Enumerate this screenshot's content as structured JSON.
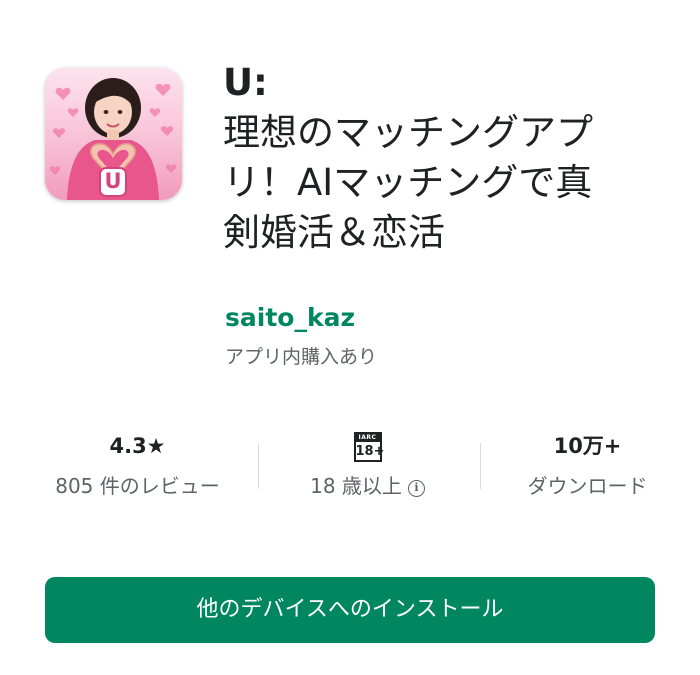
{
  "app": {
    "title_line1": "U:",
    "title_line2": "理想のマッチングアプ",
    "title_line3": "リ！AIマッチングで真",
    "title_line4": "剣婚活＆恋活",
    "developer": "saito_kaz",
    "in_app_purchases": "アプリ内購入あり",
    "icon_letter": "U"
  },
  "stats": {
    "rating": "4.3★",
    "reviews": "805 件のレビュー",
    "age_badge_header": "IARC",
    "age_badge": "18+",
    "age_label": "18 歳以上",
    "info_glyph": "i",
    "downloads": "10万+",
    "downloads_label": "ダウンロード"
  },
  "install_button": "他のデバイスへのインストール",
  "colors": {
    "accent_green": "#01875f",
    "secondary_text": "#5f6368",
    "primary_text": "#202124"
  }
}
